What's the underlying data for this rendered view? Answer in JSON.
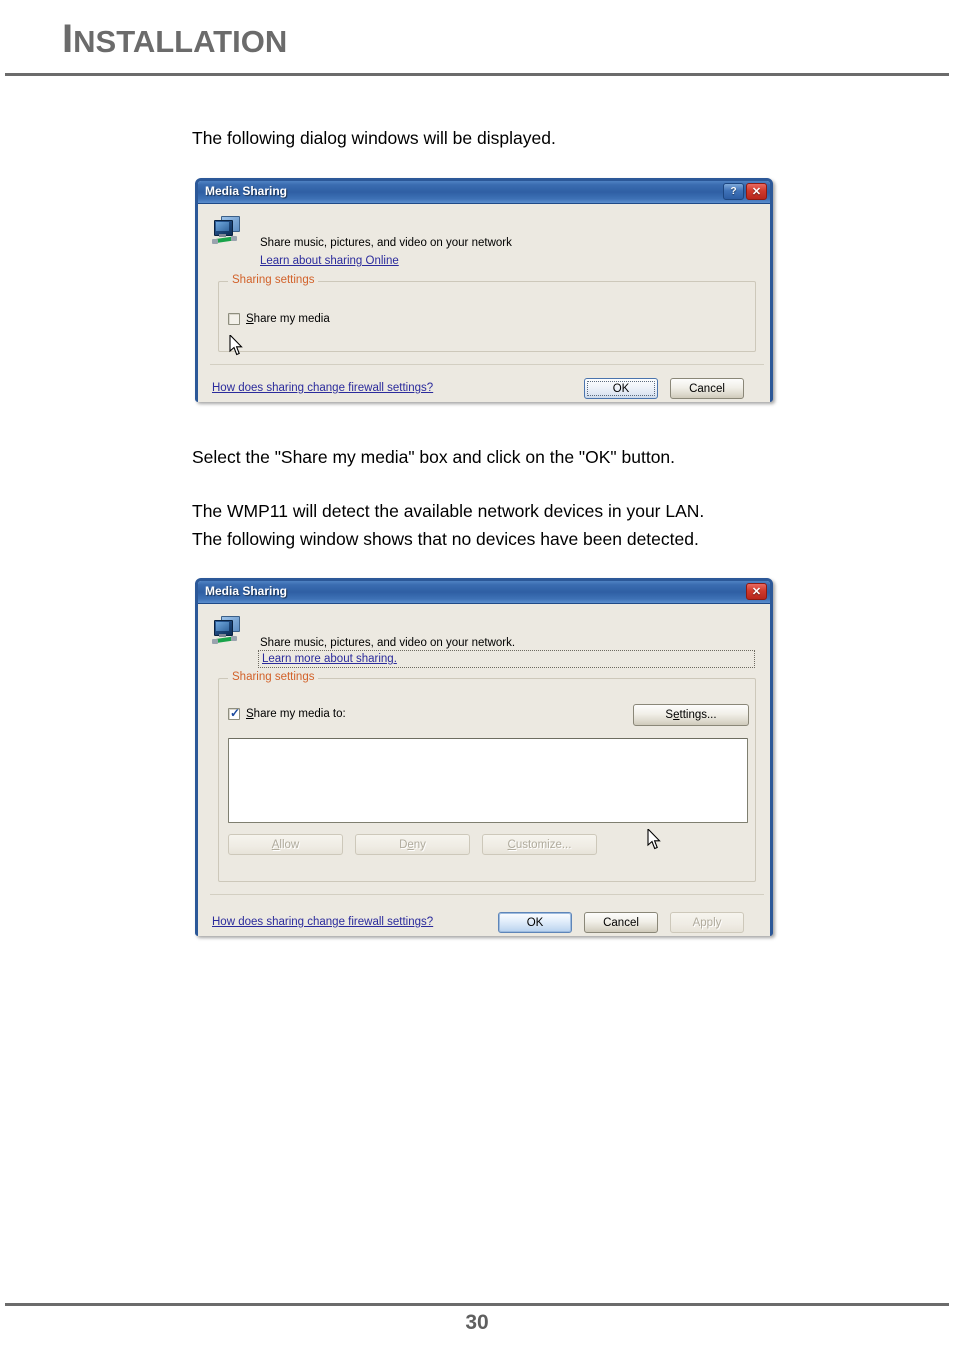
{
  "page": {
    "header_title_first": "I",
    "header_title_rest": "NSTALLATION",
    "page_number": "30",
    "paragraphs": {
      "p1": "The following dialog windows will be displayed.",
      "p2": "Select the \"Share my media\" box and click on the \"OK\" button.",
      "p3": "The WMP11 will detect the available network devices in your LAN.\nThe following window shows that no devices have been detected."
    }
  },
  "colors": {
    "header_gray": "#6b6b6b",
    "title_bar_blue": "#2f5fa4",
    "dialog_border_blue": "#2c5898",
    "dialog_face": "#ece9e1",
    "group_legend_orange": "#d2622a",
    "link_blue": "#2b2b9c",
    "close_red": "#d03a2c"
  },
  "dialog1": {
    "title": "Media Sharing",
    "help_button_label": "?",
    "close_button_label": "✕",
    "icon_name": "network-monitors-icon",
    "heading": "Share music, pictures, and video on your network",
    "link_learn": "Learn about sharing Online",
    "group_legend": "Sharing settings",
    "checkbox": {
      "accel": "S",
      "label_rest": "hare my media",
      "checked": false
    },
    "footer_link": "How does sharing change firewall settings?",
    "buttons": {
      "ok": "OK",
      "cancel": "Cancel"
    }
  },
  "dialog2": {
    "title": "Media Sharing",
    "close_button_label": "✕",
    "icon_name": "network-monitors-icon",
    "heading": "Share music, pictures, and video on your network.",
    "link_learn": "Learn more about sharing.",
    "group_legend": "Sharing settings",
    "checkbox": {
      "accel": "S",
      "label_rest": "hare my media to:",
      "checked": true
    },
    "settings_button": {
      "pre": "S",
      "accel": "e",
      "post": "ttings..."
    },
    "device_list_items": [],
    "list_buttons": [
      {
        "pre": "",
        "accel": "A",
        "post": "llow",
        "disabled": true
      },
      {
        "pre": "D",
        "accel": "e",
        "post": "ny",
        "disabled": true
      },
      {
        "pre": "",
        "accel": "C",
        "post": "ustomize...",
        "disabled": true
      }
    ],
    "footer_link": "How does sharing change firewall settings?",
    "buttons": {
      "ok": "OK",
      "cancel": "Cancel",
      "apply": "Apply"
    }
  }
}
